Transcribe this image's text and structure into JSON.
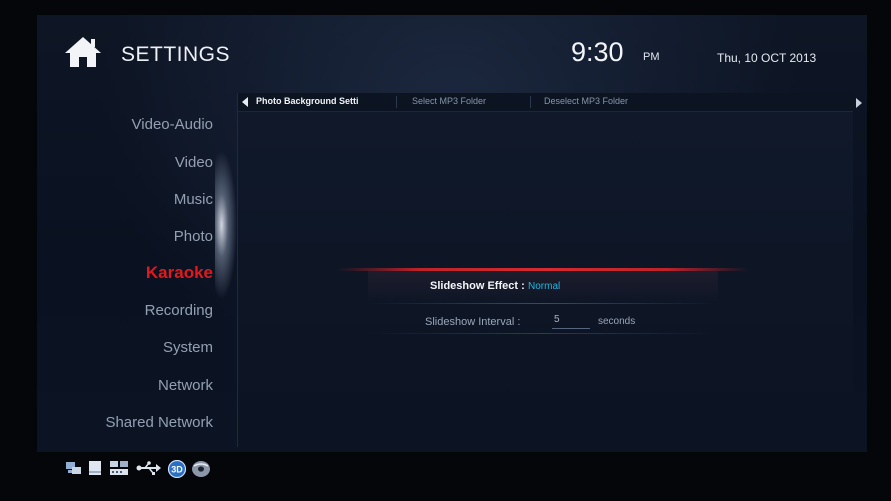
{
  "header": {
    "title": "SETTINGS",
    "time": "9:30",
    "ampm": "PM",
    "date": "Thu, 10 OCT 2013"
  },
  "sidebar": {
    "items": [
      {
        "label": "Video-Audio"
      },
      {
        "label": "Video"
      },
      {
        "label": "Music"
      },
      {
        "label": "Photo"
      },
      {
        "label": "Karaoke",
        "active": true
      },
      {
        "label": "Recording"
      },
      {
        "label": "System"
      },
      {
        "label": "Network"
      },
      {
        "label": "Shared Network"
      }
    ]
  },
  "tabs": [
    {
      "label": "Photo Background Setti",
      "active": true
    },
    {
      "label": "Select MP3 Folder"
    },
    {
      "label": "Deselect MP3 Folder"
    }
  ],
  "options": {
    "effect_label": "Slideshow Effect :",
    "effect_value": "Normal",
    "interval_label": "Slideshow Interval :",
    "interval_value": "5",
    "interval_unit": "seconds"
  },
  "status_icons": [
    "network-icon",
    "storage-icon",
    "card-reader-icon",
    "usb-icon",
    "3d-icon",
    "disc-icon"
  ],
  "colors": {
    "accent_active": "#e3181c",
    "value_highlight": "#19b9e8",
    "selection_line": "#d62a30",
    "background": "#0a1120"
  }
}
